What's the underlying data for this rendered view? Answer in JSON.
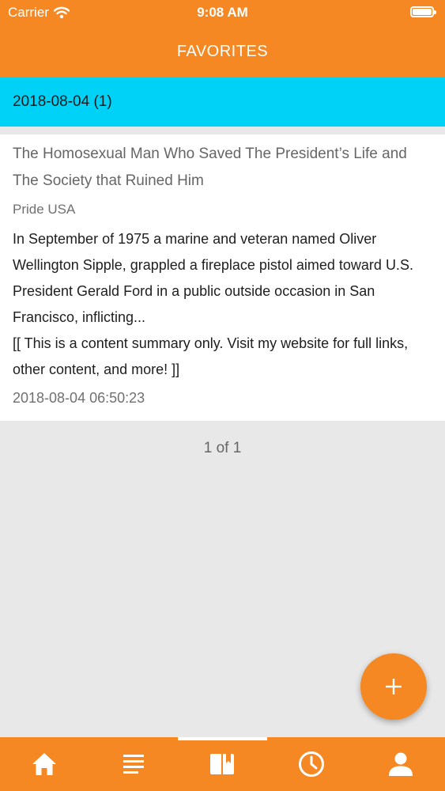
{
  "status_bar": {
    "carrier": "Carrier",
    "time": "9:08 AM",
    "wifi_icon": "wifi-icon",
    "battery_icon": "battery-icon"
  },
  "header": {
    "title": "FAVORITES"
  },
  "group": {
    "label": "2018-08-04 (1)"
  },
  "items": [
    {
      "title": "The Homosexual Man Who Saved The President’s Life and The Society that Ruined Him",
      "source": "Pride USA",
      "summary": "In September of 1975 a marine and veteran named Oliver Wellington Sipple, grappled a fireplace pistol aimed toward U.S. President Gerald Ford in a public outside occasion in San Francisco, inflicting...",
      "note": "[[ This is a content summary only. Visit my website for full links, other content, and more! ]]",
      "timestamp": "2018-08-04 06:50:23"
    }
  ],
  "pager": {
    "text": "1 of 1"
  },
  "fab": {
    "icon": "plus-icon"
  },
  "tabs": [
    {
      "icon": "home-icon",
      "active": false
    },
    {
      "icon": "list-icon",
      "active": false
    },
    {
      "icon": "book-icon",
      "active": true
    },
    {
      "icon": "clock-icon",
      "active": false
    },
    {
      "icon": "user-icon",
      "active": false
    }
  ],
  "colors": {
    "primary": "#f58823",
    "group_header": "#00d2f7",
    "background": "#e8e8e8",
    "card": "#ffffff"
  }
}
